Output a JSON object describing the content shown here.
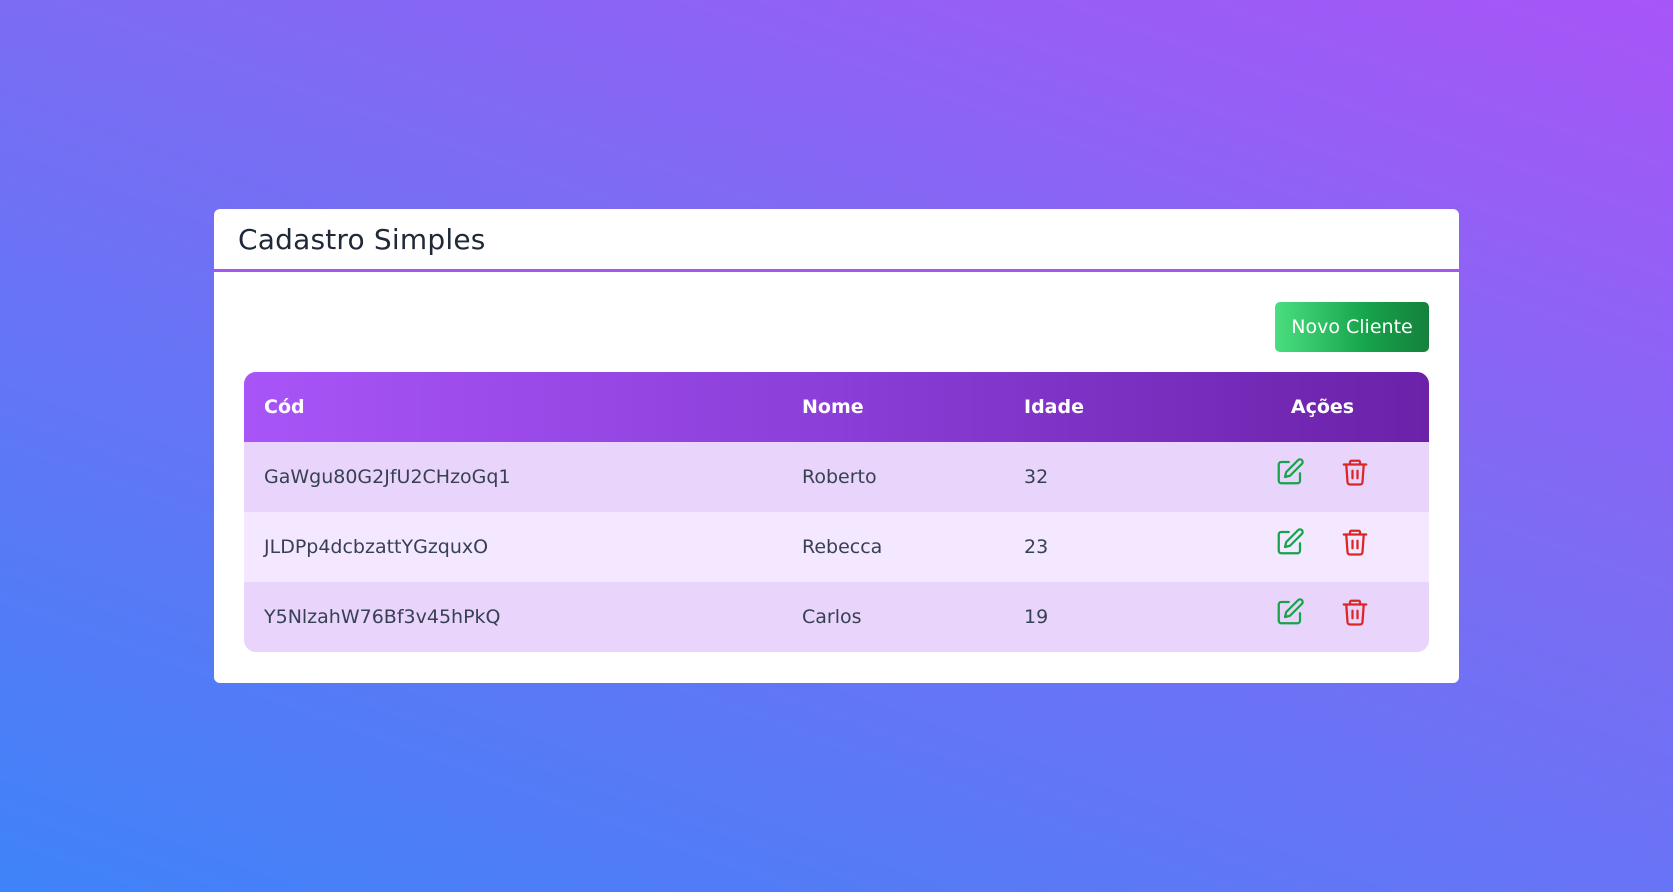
{
  "card": {
    "title": "Cadastro Simples"
  },
  "toolbar": {
    "new_client_label": "Novo Cliente"
  },
  "table": {
    "columns": [
      "Cód",
      "Nome",
      "Idade",
      "Ações"
    ],
    "rows": [
      {
        "code": "GaWgu80G2JfU2CHzoGq1",
        "name": "Roberto",
        "age": "32"
      },
      {
        "code": "JLDPp4dcbzattYGzquxO",
        "name": "Rebecca",
        "age": "23"
      },
      {
        "code": "Y5NlzahW76Bf3v45hPkQ",
        "name": "Carlos",
        "age": "19"
      }
    ],
    "action_icons": [
      "edit-icon",
      "trash-icon"
    ]
  },
  "colors": {
    "accent": "#a855f7",
    "edit": "#16a34a",
    "delete": "#dc2626"
  }
}
